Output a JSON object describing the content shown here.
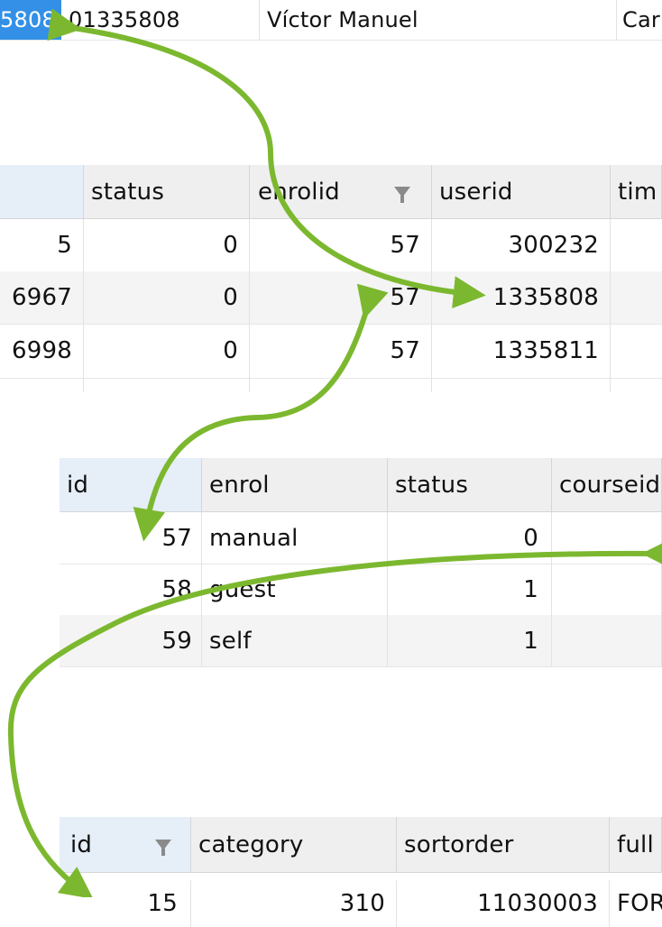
{
  "top_row": {
    "c1": "5808",
    "c2": "01335808",
    "c3": "Víctor Manuel",
    "c4": "Car"
  },
  "user_enrolments": {
    "headers": [
      "",
      "status",
      "enrolid",
      "userid",
      "tim"
    ],
    "rows": [
      [
        "5",
        "0",
        "57",
        "300232"
      ],
      [
        "6967",
        "0",
        "57",
        "1335808"
      ],
      [
        "6998",
        "0",
        "57",
        "1335811"
      ]
    ]
  },
  "enrol": {
    "headers": [
      "id",
      "enrol",
      "status",
      "courseid"
    ],
    "rows": [
      [
        "57",
        "manual",
        "0"
      ],
      [
        "58",
        "guest",
        "1"
      ],
      [
        "59",
        "self",
        "1"
      ]
    ]
  },
  "course": {
    "headers": [
      "id",
      "category",
      "sortorder",
      "full"
    ],
    "rows": [
      [
        "15",
        "310",
        "11030003",
        "FOR"
      ]
    ]
  },
  "colors": {
    "arrow": "#7cb82f",
    "selection": "#3390e6"
  },
  "icons": [
    "filter-icon"
  ]
}
